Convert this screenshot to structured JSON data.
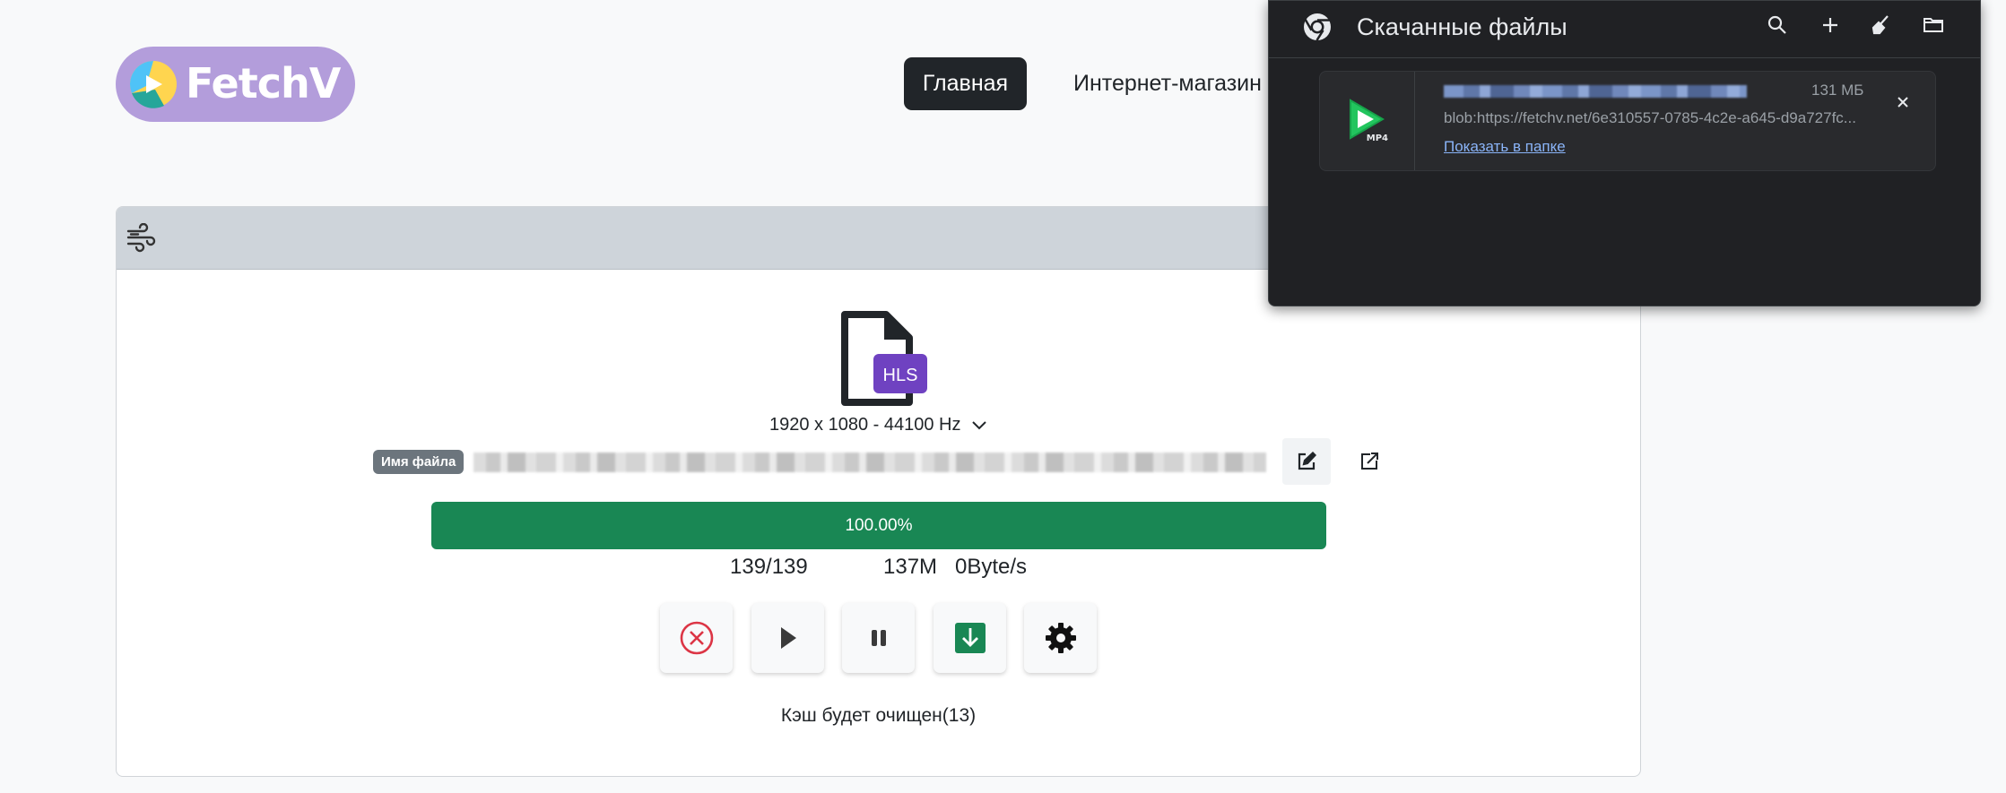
{
  "logo": {
    "text": "FetchV"
  },
  "nav": {
    "home": "Главная",
    "shop": "Интернет-магазин"
  },
  "card": {
    "header_icon": "wind-icon",
    "file_badge": "HLS",
    "meta": "1920 x 1080 - 44100 Hz",
    "filename_label": "Имя файла",
    "progress": {
      "percent": 100,
      "label": "100.00%"
    },
    "stats": {
      "count": "139/139",
      "size": "137M",
      "speed": "0Byte/s"
    },
    "buttons": [
      "cancel-icon",
      "play-icon",
      "pause-icon",
      "save-icon",
      "gear-icon"
    ],
    "cache_note": "Кэш будет очищен(13)"
  },
  "downloads": {
    "title": "Скачанные файлы",
    "item": {
      "size": "131 МБ",
      "url": "blob:https://fetchv.net/6e310557-0785-4c2e-a645-d9a727fc...",
      "show_in_folder": "Показать в папке",
      "icon_badge": "MP4"
    }
  },
  "colors": {
    "accent": "#198754",
    "logo_bg": "#b39ddb",
    "hls_badge": "#6f42c1",
    "link": "#8ab4f8",
    "popup_bg": "#202124"
  }
}
